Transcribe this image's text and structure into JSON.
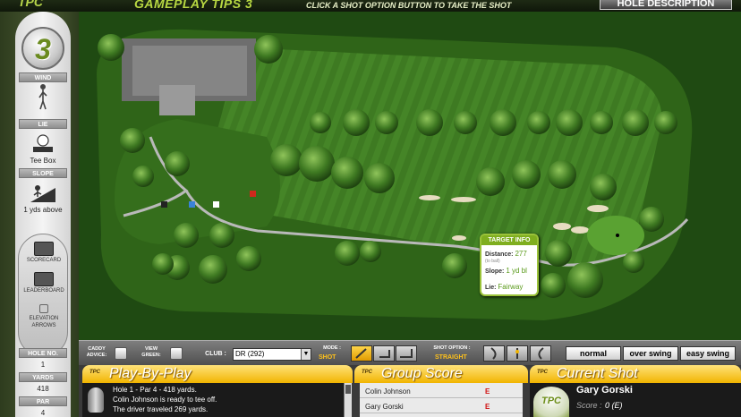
{
  "header": {
    "logo": "TPC",
    "title": "GAMEPLAY TIPS 3",
    "instruction": "CLICK A SHOT OPTION BUTTON TO TAKE THE SHOT",
    "hole_description_button": "HOLE DESCRIPTION"
  },
  "left_panel": {
    "hole_badge": "3",
    "wind_label": "WIND",
    "lie_label": "LIE",
    "lie_value": "Tee Box",
    "slope_label": "SLOPE",
    "slope_value": "1 yds above",
    "nav": {
      "scorecard": "SCORECARD",
      "leaderboard": "LEADERBOARD",
      "elevation_arrows": "ELEVATION ARROWS"
    },
    "hole_no_label": "HOLE NO.",
    "hole_no_value": "1",
    "yards_label": "YARDS",
    "yards_value": "418",
    "par_label": "PAR",
    "par_value": "4"
  },
  "target_info": {
    "title": "TARGET INFO",
    "distance_label": "Distance:",
    "distance_value": "277",
    "distance_sub": "(to ball)",
    "slope_label": "Slope:",
    "slope_value": "1 yd bl",
    "lie_label": "Lie:",
    "lie_value": "Fairway"
  },
  "controls": {
    "caddy_advice": "CADDY ADVICE:",
    "view_green": "VIEW GREEN:",
    "club_label": "CLUB :",
    "club_value": "DR (292)",
    "mode_label": "MODE :",
    "mode_value": "SHOT",
    "shot_option_label": "SHOT OPTION :",
    "shot_option_value": "STRAIGHT",
    "swing_buttons": [
      "normal",
      "over swing",
      "easy swing"
    ]
  },
  "play_by_play": {
    "title": "Play-By-Play",
    "lines": [
      "Hole 1 - Par 4 - 418 yards.",
      "Colin Johnson is ready to tee off.",
      "The driver traveled 269 yards."
    ]
  },
  "group_score": {
    "title": "Group Score",
    "rows": [
      {
        "name": "Colin Johnson",
        "score": "E"
      },
      {
        "name": "Gary Gorski",
        "score": "E"
      }
    ]
  },
  "current_shot": {
    "title": "Current Shot",
    "player": "Gary Gorski",
    "score_label": "Score :",
    "score_value": "0 (E)"
  },
  "colors": {
    "accent_yellow": "#f1b400",
    "course_green": "#3f7a26",
    "score_red": "#d01010"
  }
}
